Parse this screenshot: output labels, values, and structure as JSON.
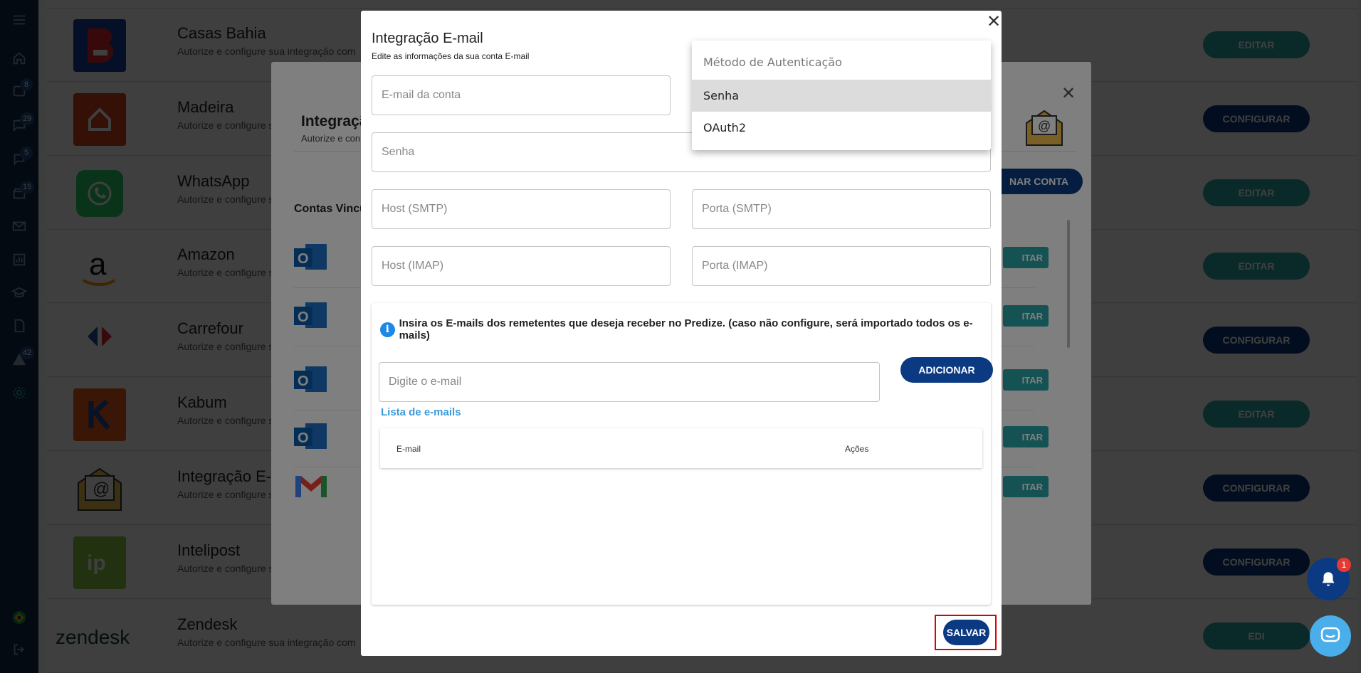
{
  "sidebar": {
    "badges": [
      "8",
      "29",
      "5",
      "15",
      "42"
    ]
  },
  "integrations": [
    {
      "name": "Casas Bahia",
      "desc": "Autorize e configure sua integração com",
      "action": "EDITAR",
      "active": false,
      "logo_color": "#1a3fa3"
    },
    {
      "name": "Madeira",
      "desc": "Autorize e configure s",
      "action": "CONFIGURAR",
      "active": true,
      "logo_color": "#d0401f"
    },
    {
      "name": "WhatsApp",
      "desc": "Autorize e configure s",
      "action": "EDITAR",
      "active": false,
      "logo_color": "#25d366"
    },
    {
      "name": "Amazon",
      "desc": "Autorize e configure s",
      "action": "EDITAR",
      "active": false,
      "logo_color": "#ffffff"
    },
    {
      "name": "Carrefour",
      "desc": "Autorize e configure s",
      "action": "CONFIGURAR",
      "active": true,
      "logo_color": "#ffffff"
    },
    {
      "name": "Kabum",
      "desc": "Autorize e configure s",
      "action": "EDITAR",
      "active": false,
      "logo_color": "#e8581a"
    },
    {
      "name": "Integração E-",
      "desc": "Autorize e configure s",
      "action": "CONFIGURAR",
      "active": true,
      "logo_color": "#ffffff"
    },
    {
      "name": "Intelipost",
      "desc": "Autorize e configure s",
      "action": "CONFIGURAR",
      "active": true,
      "logo_color": "#8ac43f"
    },
    {
      "name": "Zendesk",
      "desc": "Autorize e configure sua integração com",
      "action": "EDI",
      "active": false,
      "logo_color": "#ffffff"
    }
  ],
  "middle_modal": {
    "title": "Integraçã",
    "subtitle": "Autorize e con",
    "link_button": "NAR CONTA",
    "section": "Contas Vincu",
    "edit_label": "ITAR"
  },
  "modal": {
    "title": "Integração E-mail",
    "subtitle": "Edite as informações da sua conta E-mail",
    "fields": {
      "email_placeholder": "E-mail da conta",
      "password_placeholder": "Senha",
      "smtp_host_placeholder": "Host (SMTP)",
      "smtp_port_placeholder": "Porta (SMTP)",
      "imap_host_placeholder": "Host (IMAP)",
      "imap_port_placeholder": "Porta (IMAP)"
    },
    "info_text": "Insira os E-mails dos remetentes que deseja receber no Predize. (caso não configure, será importado todos os e-mails)",
    "sender_placeholder": "Digite o e-mail",
    "add_button": "ADICIONAR",
    "list_title": "Lista de e-mails",
    "table_headers": {
      "email": "E-mail",
      "actions": "Ações"
    },
    "save_button": "SALVAR"
  },
  "auth_dropdown": {
    "label": "Método de Autenticação",
    "options": [
      "Senha",
      "OAuth2"
    ],
    "selected": "Senha"
  },
  "notifications": {
    "count": "1"
  },
  "colors": {
    "primary": "#0b3a82",
    "teal": "#2aa4a6",
    "sidebar": "#0e2a47",
    "highlight": "#e00000"
  }
}
